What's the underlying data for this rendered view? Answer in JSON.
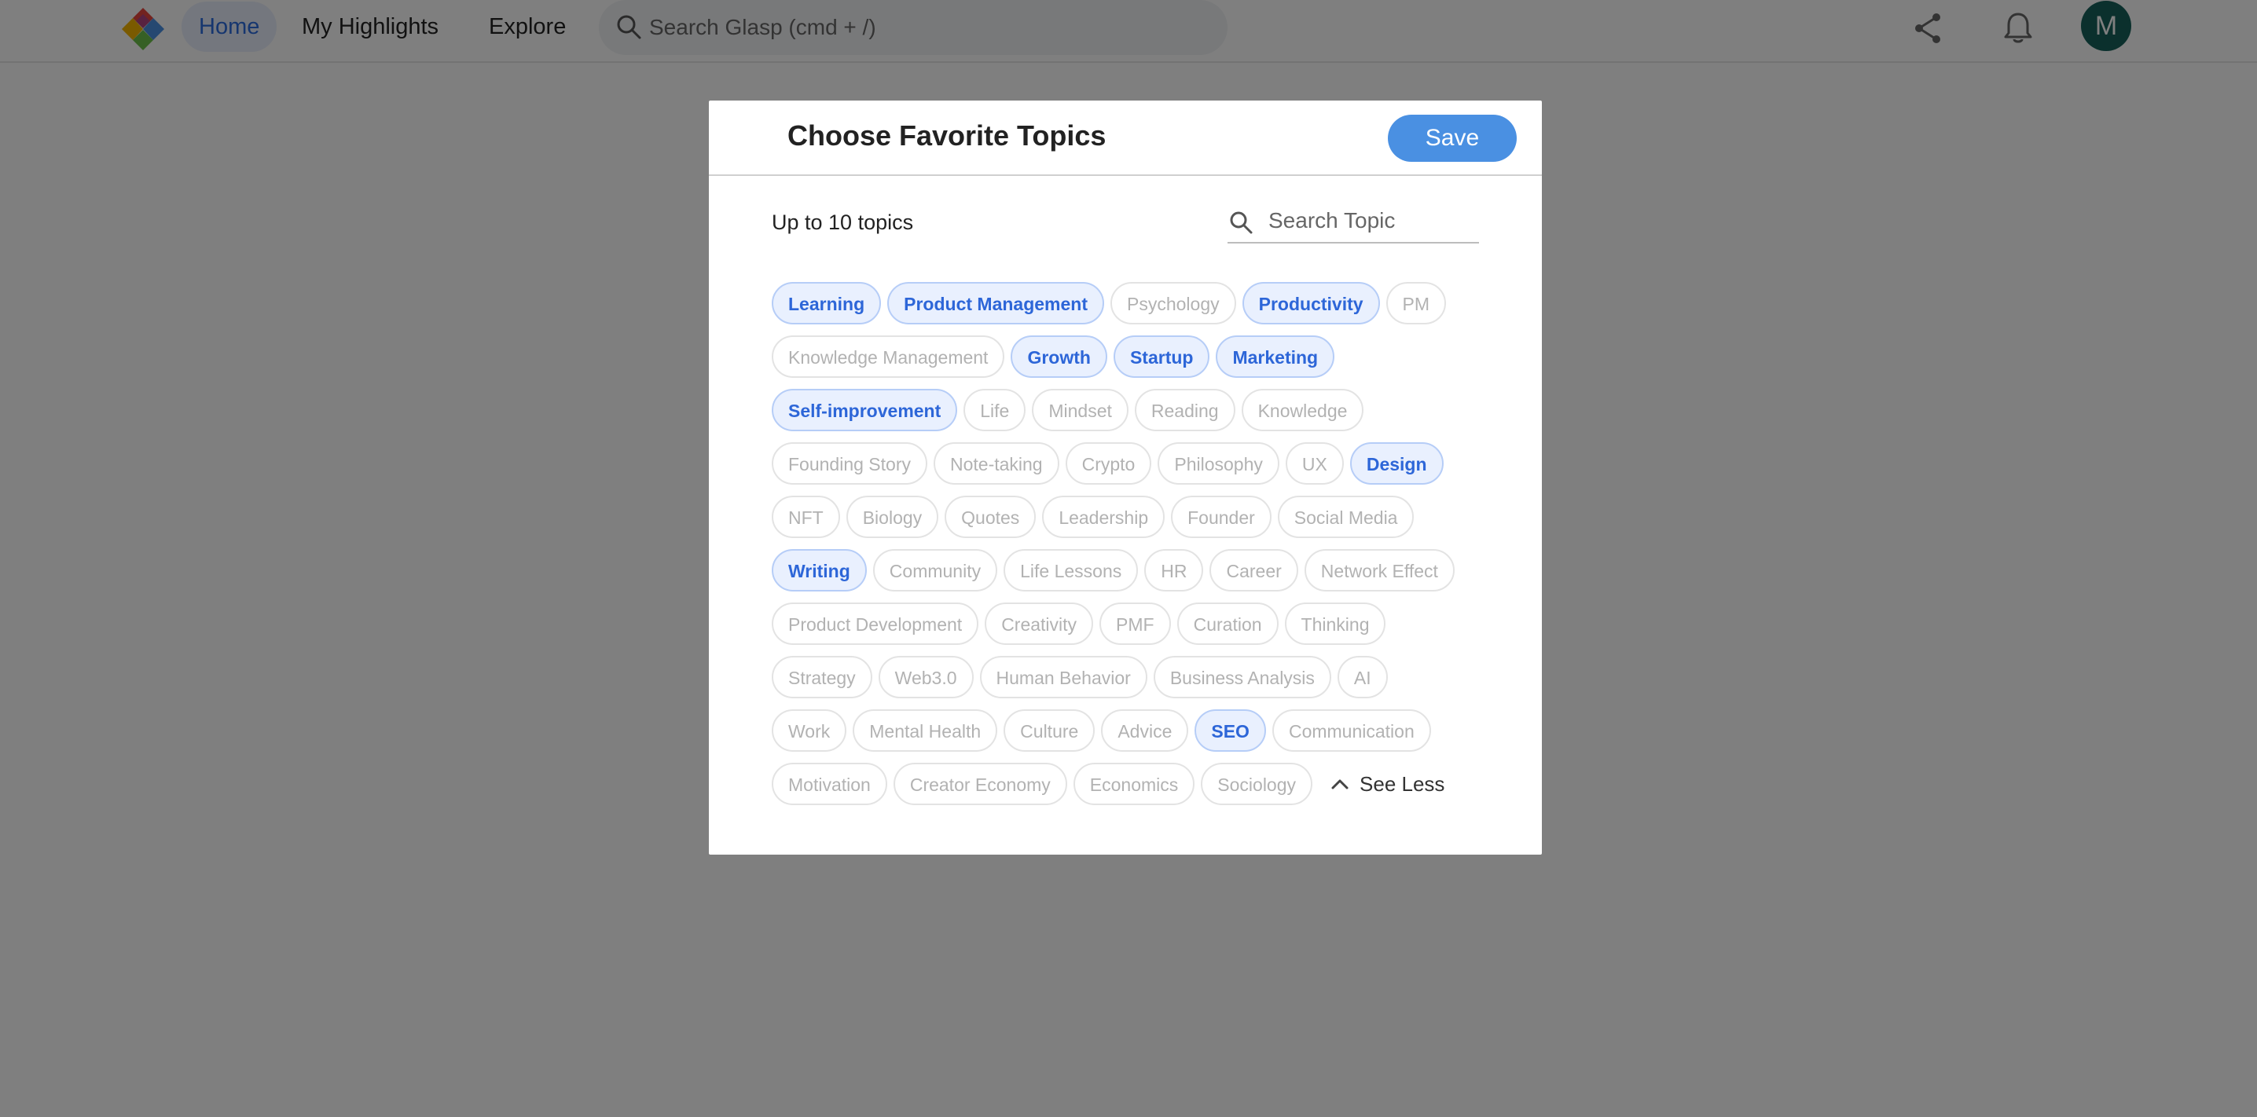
{
  "nav": {
    "home": "Home",
    "my_highlights": "My Highlights",
    "explore": "Explore",
    "search_placeholder": "Search Glasp (cmd + /)",
    "avatar_initial": "M"
  },
  "modal": {
    "title": "Choose Favorite Topics",
    "save_label": "Save",
    "subtitle": "Up to 10 topics",
    "search_placeholder": "Search Topic",
    "see_less_label": "See Less",
    "topics": [
      [
        {
          "label": "Learning",
          "selected": true
        },
        {
          "label": "Product Management",
          "selected": true
        },
        {
          "label": "Psychology",
          "selected": false
        },
        {
          "label": "Productivity",
          "selected": true
        },
        {
          "label": "PM",
          "selected": false
        }
      ],
      [
        {
          "label": "Knowledge Management",
          "selected": false
        },
        {
          "label": "Growth",
          "selected": true
        },
        {
          "label": "Startup",
          "selected": true
        },
        {
          "label": "Marketing",
          "selected": true
        }
      ],
      [
        {
          "label": "Self-improvement",
          "selected": true
        },
        {
          "label": "Life",
          "selected": false
        },
        {
          "label": "Mindset",
          "selected": false
        },
        {
          "label": "Reading",
          "selected": false
        },
        {
          "label": "Knowledge",
          "selected": false
        }
      ],
      [
        {
          "label": "Founding Story",
          "selected": false
        },
        {
          "label": "Note-taking",
          "selected": false
        },
        {
          "label": "Crypto",
          "selected": false
        },
        {
          "label": "Philosophy",
          "selected": false
        },
        {
          "label": "UX",
          "selected": false
        },
        {
          "label": "Design",
          "selected": true
        }
      ],
      [
        {
          "label": "NFT",
          "selected": false
        },
        {
          "label": "Biology",
          "selected": false
        },
        {
          "label": "Quotes",
          "selected": false
        },
        {
          "label": "Leadership",
          "selected": false
        },
        {
          "label": "Founder",
          "selected": false
        },
        {
          "label": "Social Media",
          "selected": false
        }
      ],
      [
        {
          "label": "Writing",
          "selected": true
        },
        {
          "label": "Community",
          "selected": false
        },
        {
          "label": "Life Lessons",
          "selected": false
        },
        {
          "label": "HR",
          "selected": false
        },
        {
          "label": "Career",
          "selected": false
        },
        {
          "label": "Network Effect",
          "selected": false
        }
      ],
      [
        {
          "label": "Product Development",
          "selected": false
        },
        {
          "label": "Creativity",
          "selected": false
        },
        {
          "label": "PMF",
          "selected": false
        },
        {
          "label": "Curation",
          "selected": false
        },
        {
          "label": "Thinking",
          "selected": false
        }
      ],
      [
        {
          "label": "Strategy",
          "selected": false
        },
        {
          "label": "Web3.0",
          "selected": false
        },
        {
          "label": "Human Behavior",
          "selected": false
        },
        {
          "label": "Business Analysis",
          "selected": false
        },
        {
          "label": "AI",
          "selected": false
        }
      ],
      [
        {
          "label": "Work",
          "selected": false
        },
        {
          "label": "Mental Health",
          "selected": false
        },
        {
          "label": "Culture",
          "selected": false
        },
        {
          "label": "Advice",
          "selected": false
        },
        {
          "label": "SEO",
          "selected": true
        },
        {
          "label": "Communication",
          "selected": false
        }
      ],
      [
        {
          "label": "Motivation",
          "selected": false
        },
        {
          "label": "Creator Economy",
          "selected": false
        },
        {
          "label": "Economics",
          "selected": false
        },
        {
          "label": "Sociology",
          "selected": false
        }
      ]
    ]
  },
  "icons": {
    "logo": "glasp-logo",
    "search": "search-icon",
    "share": "share-icon",
    "notification": "bell-icon",
    "see_less": "chevron-up-icon"
  },
  "colors": {
    "accent": "#4a90e2",
    "selected_chip_bg": "#e9f0fe",
    "selected_chip_text": "#2d66d8",
    "avatar_bg": "#16615a",
    "overlay": "rgba(0,0,0,0.5)"
  }
}
